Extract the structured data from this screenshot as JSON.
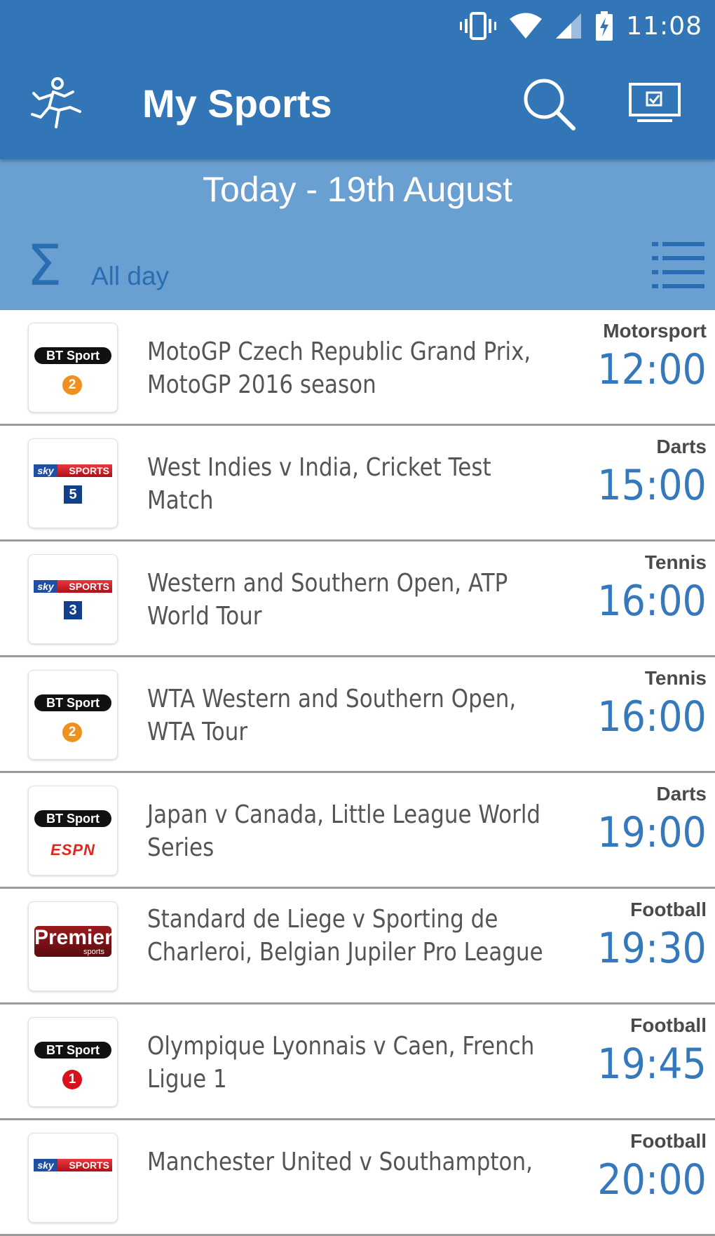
{
  "status_bar": {
    "time": "11:08"
  },
  "app_bar": {
    "title": "My Sports"
  },
  "header": {
    "date": "Today - 19th August",
    "filter": "All day"
  },
  "colors": {
    "primary": "#3276b7",
    "subheader": "#6aa0d1",
    "accent": "#3579bc"
  },
  "events": [
    {
      "channel": "BT Sport 2",
      "channel_name": "BT Sport",
      "channel_sub": "2",
      "title": "MotoGP Czech Republic Grand Prix, MotoGP 2016 season",
      "sport": "Motorsport",
      "time": "12:00"
    },
    {
      "channel": "Sky Sports 5",
      "channel_name": "SPORTS",
      "channel_brand": "sky",
      "channel_sub": "5",
      "title": "West Indies v India, Cricket Test Match",
      "sport": "Darts",
      "time": "15:00"
    },
    {
      "channel": "Sky Sports 3",
      "channel_name": "SPORTS",
      "channel_brand": "sky",
      "channel_sub": "3",
      "title": "Western and Southern Open, ATP World Tour",
      "sport": "Tennis",
      "time": "16:00"
    },
    {
      "channel": "BT Sport 2",
      "channel_name": "BT Sport",
      "channel_sub": "2",
      "title": "WTA Western and Southern Open, WTA Tour",
      "sport": "Tennis",
      "time": "16:00"
    },
    {
      "channel": "BT Sport ESPN",
      "channel_name": "BT Sport",
      "channel_sub": "ESPN",
      "title": "Japan v Canada, Little League World Series",
      "sport": "Darts",
      "time": "19:00"
    },
    {
      "channel": "Premier Sports",
      "channel_name": "Premier",
      "channel_sub": "sports",
      "title": "Standard de Liege v Sporting de Charleroi, Belgian Jupiler Pro League",
      "sport": "Football",
      "time": "19:30"
    },
    {
      "channel": "BT Sport 1",
      "channel_name": "BT Sport",
      "channel_sub": "1",
      "title": "Olympique Lyonnais v Caen, French Ligue 1",
      "sport": "Football",
      "time": "19:45"
    },
    {
      "channel": "Sky Sports",
      "channel_name": "SPORTS",
      "channel_brand": "sky",
      "channel_sub": "",
      "title": "Manchester United v Southampton,",
      "sport": "Football",
      "time": "20:00"
    }
  ]
}
